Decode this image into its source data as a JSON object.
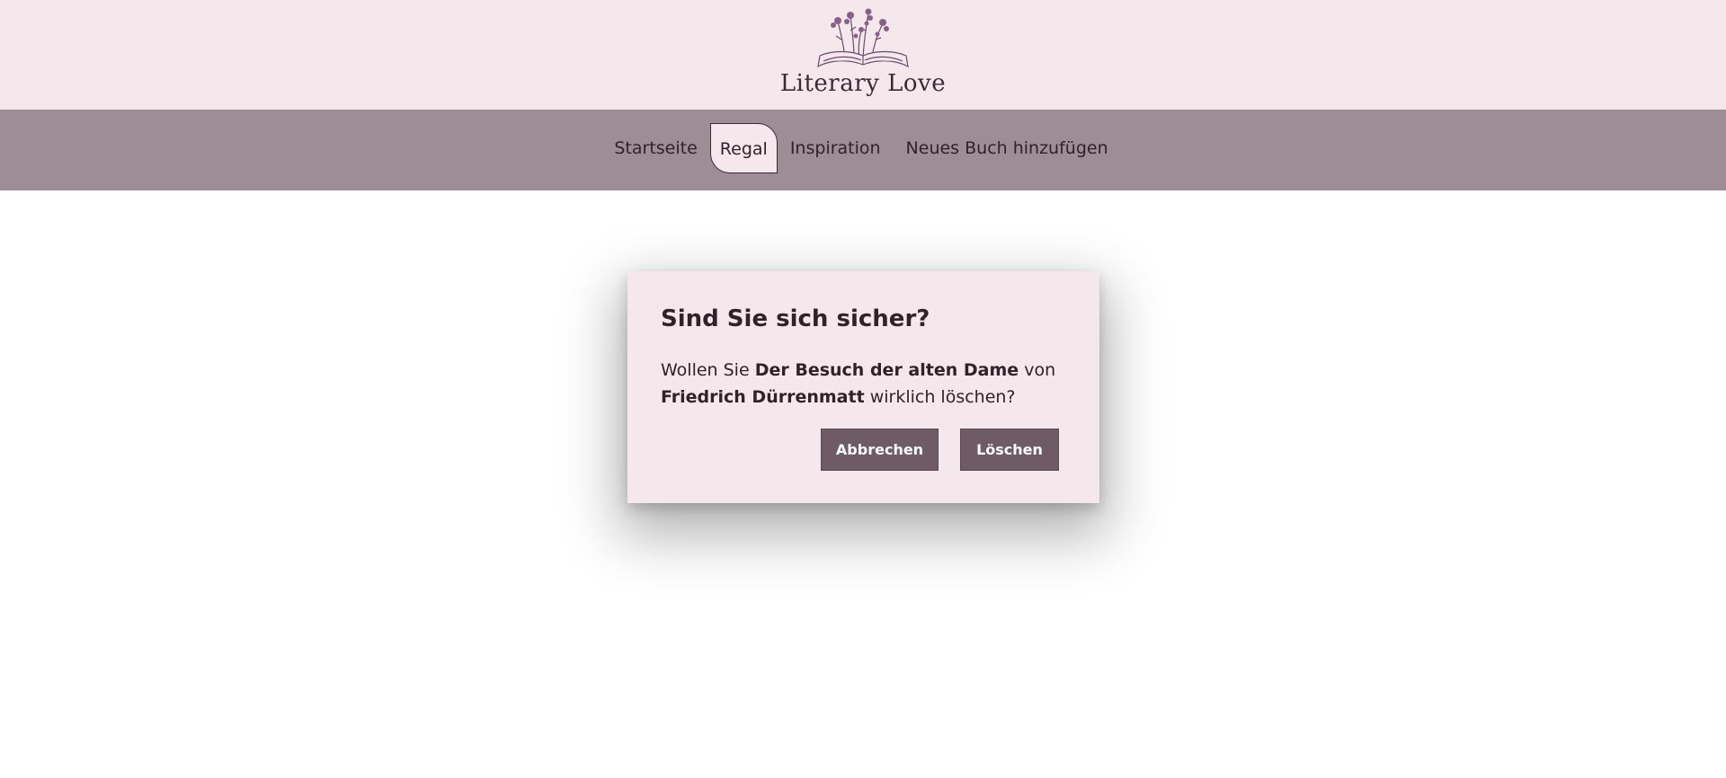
{
  "header": {
    "logo_text": "Literary Love",
    "logo_icon": "book-with-flowers-icon"
  },
  "nav": {
    "items": [
      {
        "label": "Startseite",
        "active": false
      },
      {
        "label": "Regal",
        "active": true
      },
      {
        "label": "Inspiration",
        "active": false
      },
      {
        "label": "Neues Buch hinzufügen",
        "active": false
      }
    ]
  },
  "dialog": {
    "title": "Sind Sie sich sicher?",
    "message_prefix": "Wollen Sie ",
    "book_title": "Der Besuch der alten Dame",
    "message_mid": " von ",
    "author": "Friedrich Dürrenmatt",
    "message_suffix": " wirklich löschen?",
    "cancel_label": "Abbrechen",
    "delete_label": "Löschen"
  },
  "colors": {
    "header_bg": "#f5e8ec",
    "nav_bg": "#9e8c96",
    "button_bg": "#6e5b66",
    "text": "#2f2229"
  }
}
